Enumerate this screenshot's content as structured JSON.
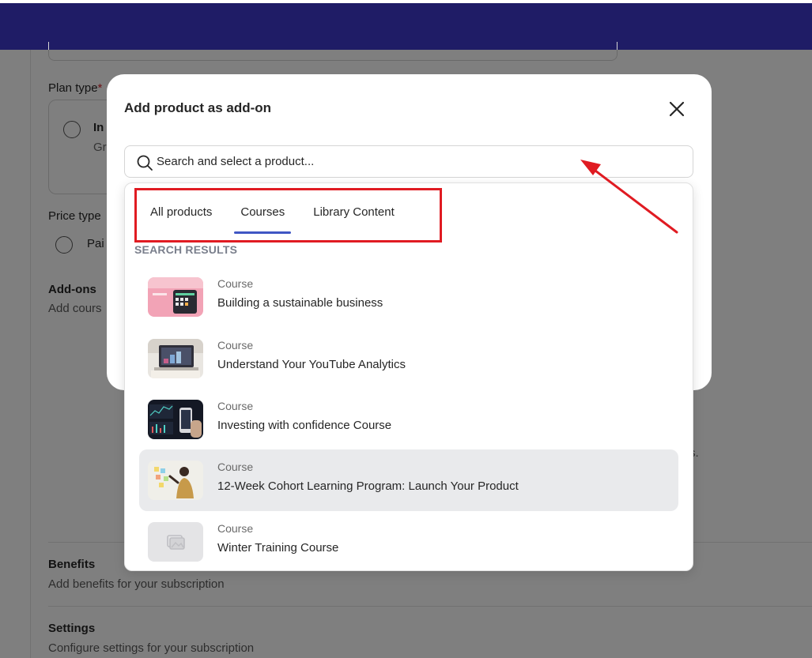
{
  "colors": {
    "header": "#1f1c66",
    "accent": "#3f56c4",
    "annotation": "#e01b22"
  },
  "background": {
    "plan_type_label": "Plan type",
    "required_mark": "*",
    "plan_option_title": "In",
    "plan_option_desc": "Gr us",
    "price_type_label": "Price type",
    "price_option": "Pai",
    "addons_title": "Add-ons",
    "addons_desc": "Add cours",
    "stray_text": "s.",
    "benefits_title": "Benefits",
    "benefits_desc": "Add benefits for your subscription",
    "settings_title": "Settings",
    "settings_desc": "Configure settings for your subscription"
  },
  "modal": {
    "title": "Add product as add-on",
    "close_icon": "close-icon",
    "search": {
      "placeholder": "Search and select a product...",
      "icon": "search-icon"
    }
  },
  "dropdown": {
    "tabs": [
      {
        "label": "All products",
        "active": false
      },
      {
        "label": "Courses",
        "active": true
      },
      {
        "label": "Library Content",
        "active": false
      }
    ],
    "results_heading": "SEARCH RESULTS",
    "results": [
      {
        "type": "Course",
        "name": "Building a sustainable business",
        "thumb": "pink-desk-photo"
      },
      {
        "type": "Course",
        "name": "Understand Your YouTube Analytics",
        "thumb": "laptop-photo"
      },
      {
        "type": "Course",
        "name": "Investing with confidence Course",
        "thumb": "trading-screen-photo"
      },
      {
        "type": "Course",
        "name": "12-Week Cohort Learning Program: Launch Your Product",
        "thumb": "whiteboard-person-photo"
      },
      {
        "type": "Course",
        "name": "Winter Training Course",
        "thumb": "image-placeholder-icon"
      }
    ]
  }
}
